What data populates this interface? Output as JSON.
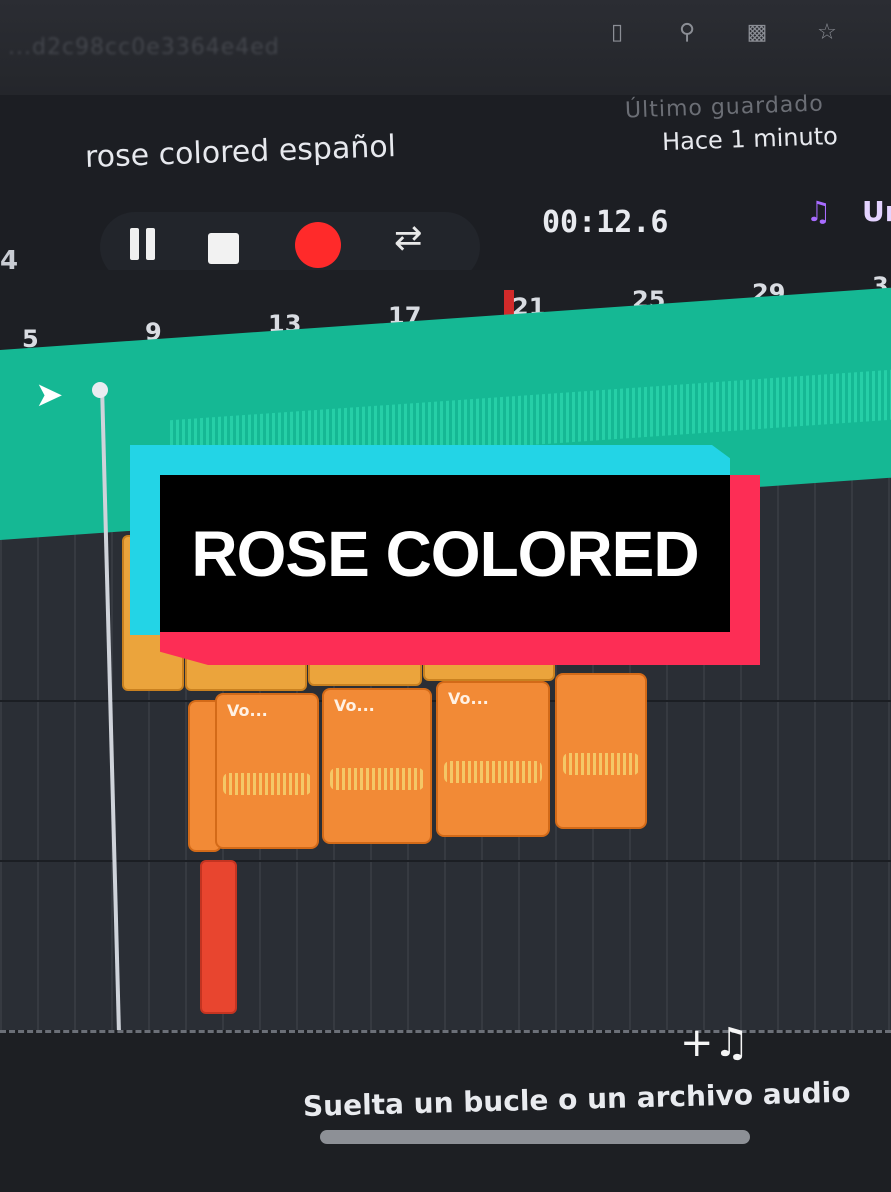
{
  "browser": {
    "url_fragment": "...d2c98cc0e3364e4ed",
    "icons": [
      "sidebar-icon",
      "search-icon",
      "cast-icon",
      "bookmark-star-icon"
    ]
  },
  "header": {
    "project_title": "rose colored español",
    "saved_label": "Último guardado",
    "saved_time": "Hace 1 minuto"
  },
  "transport": {
    "edge_number": "4",
    "pause_label": "",
    "stop_label": "",
    "record_label": "",
    "time": "00:12.6",
    "music_icon": "music-note-icon",
    "music_label": "Ur"
  },
  "ruler": {
    "numbers": [
      "5",
      "9",
      "13",
      "17",
      "21",
      "25",
      "29",
      "3"
    ]
  },
  "tracks": {
    "vocal_clips": [
      {
        "label": "Vo..."
      },
      {
        "label": "Vo..."
      },
      {
        "label": "Vo..."
      },
      {
        "label": ""
      }
    ]
  },
  "drop_zone": {
    "icon": "add-music-icon",
    "text": "Suelta un bucle o un archivo audio"
  },
  "overlay": {
    "title": "ROSE COLORED"
  },
  "colors": {
    "teal_track": "#15b894",
    "yellow_clip": "#eba43c",
    "orange_clip": "#f28a36",
    "red_clip": "#e8452f",
    "record": "#ff2a2a",
    "overlay_cyan": "#23d4e6",
    "overlay_red": "#fd2d55"
  }
}
